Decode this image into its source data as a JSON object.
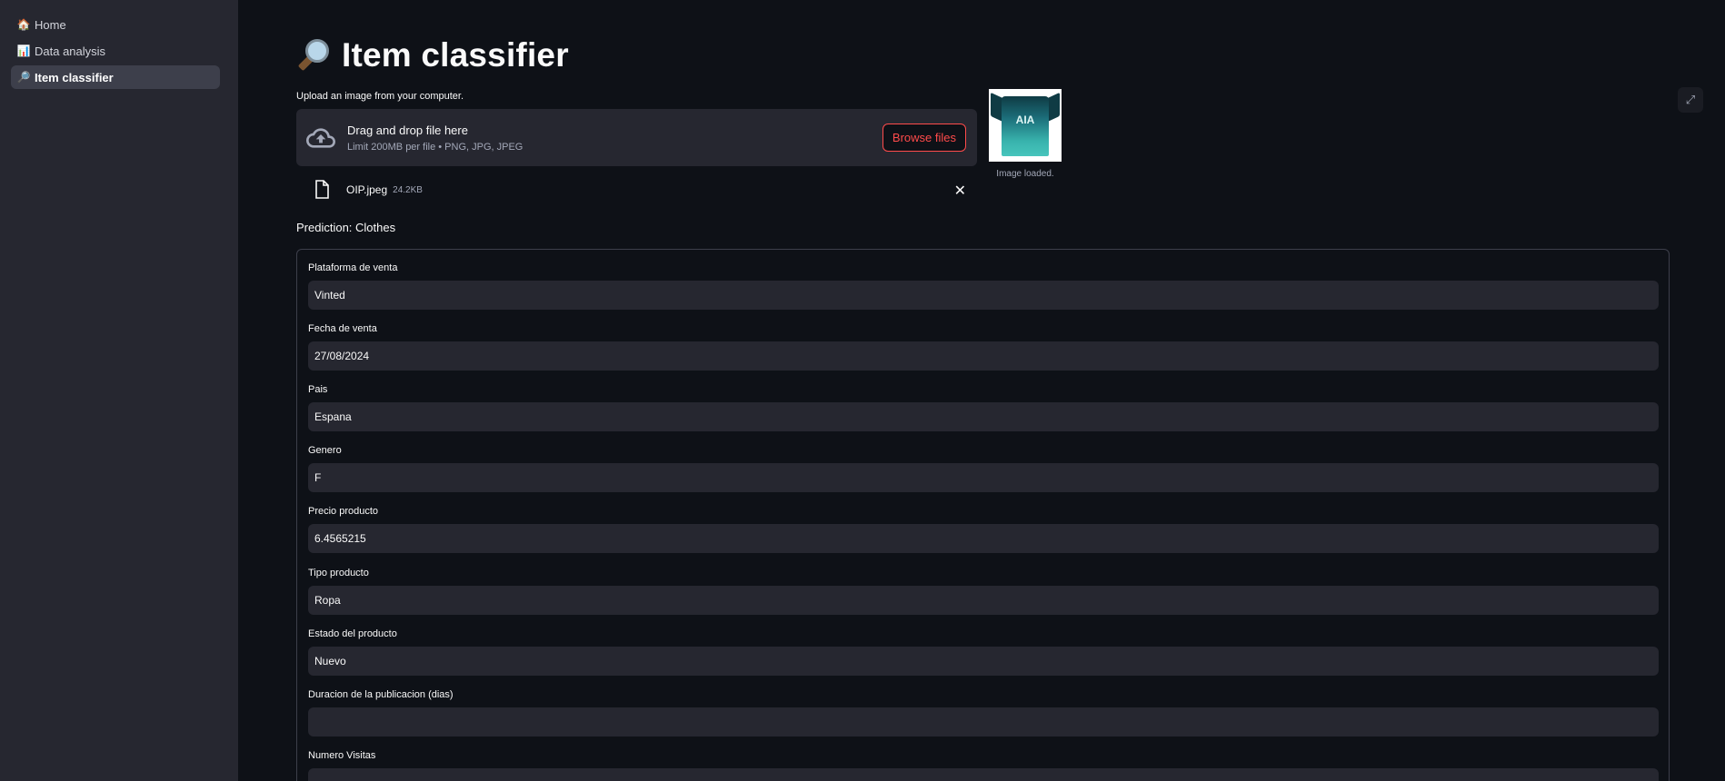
{
  "sidebar": {
    "items": [
      {
        "icon": "house-icon",
        "glyph": "🏠",
        "label": "Home"
      },
      {
        "icon": "bar-chart-icon",
        "glyph": "📊",
        "label": "Data analysis"
      },
      {
        "icon": "magnifier-icon",
        "glyph": "🔎",
        "label": "Item classifier"
      }
    ],
    "active_item": "Item classifier"
  },
  "page": {
    "title": "Item classifier",
    "title_icon": "magnifier-icon"
  },
  "uploader": {
    "label": "Upload an image from your computer.",
    "drop_text": "Drag and drop file here",
    "limit_text": "Limit 200MB per file • PNG, JPG, JPEG",
    "browse_label": "Browse files",
    "file_name": "OIP.jpeg",
    "file_size": "24.2KB"
  },
  "preview": {
    "shirt_text": "AIA",
    "caption": "Image loaded."
  },
  "prediction": "Prediction: Clothes",
  "form": {
    "fields": [
      {
        "label": "Plataforma de venta",
        "value": "Vinted"
      },
      {
        "label": "Fecha de venta",
        "value": "27/08/2024"
      },
      {
        "label": "Pais",
        "value": "Espana"
      },
      {
        "label": "Genero",
        "value": "F"
      },
      {
        "label": "Precio producto",
        "value": "6.4565215"
      },
      {
        "label": "Tipo producto",
        "value": "Ropa"
      },
      {
        "label": "Estado del producto",
        "value": "Nuevo"
      },
      {
        "label": "Duracion de la publicacion (dias)",
        "value": ""
      },
      {
        "label": "Numero Visitas",
        "value": ""
      }
    ]
  },
  "colors": {
    "accent": "#ff4b4b",
    "background": "#0e1117",
    "sidebar": "#262730",
    "input": "#262730"
  }
}
